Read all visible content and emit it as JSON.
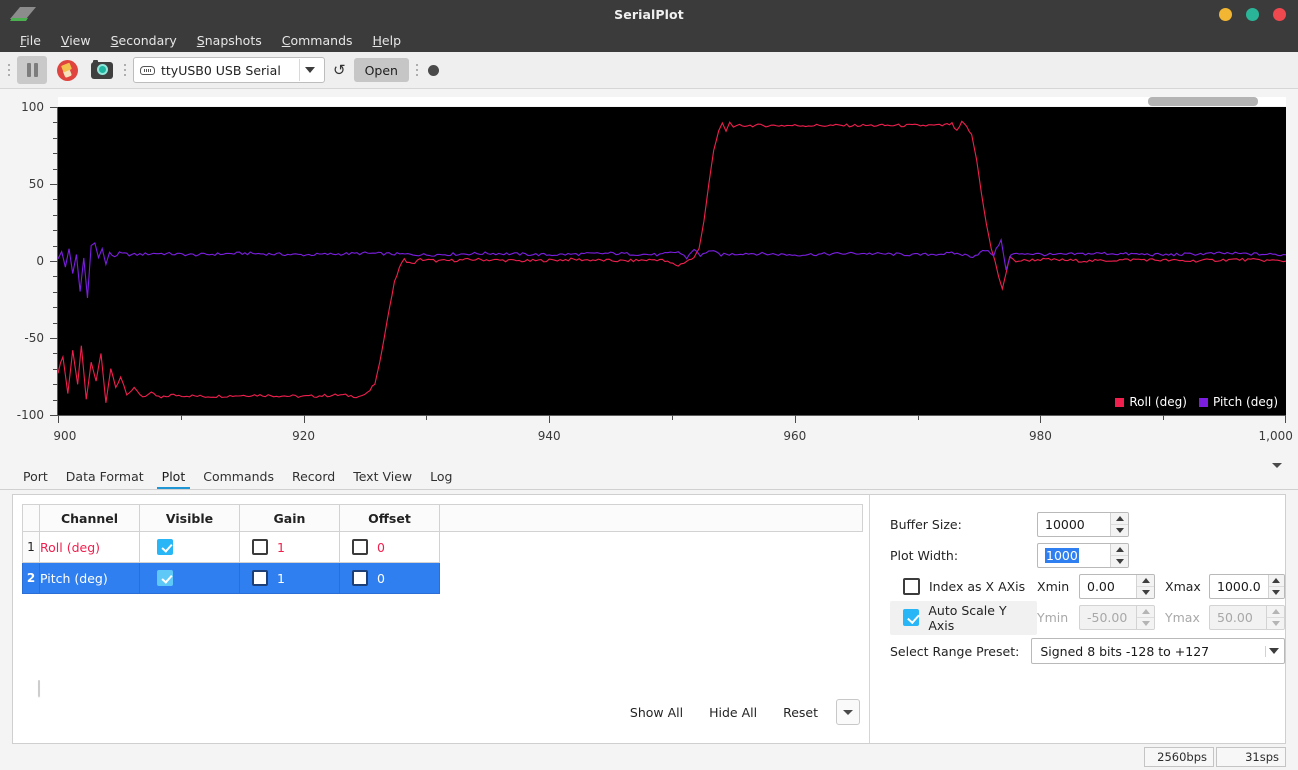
{
  "window": {
    "title": "SerialPlot",
    "logo_icon": "serialplot-logo-icon",
    "buttons": [
      {
        "name": "minimize",
        "color": "#f2b632"
      },
      {
        "name": "maximize",
        "color": "#2bb598"
      },
      {
        "name": "close",
        "color": "#f0484f"
      }
    ]
  },
  "menubar": {
    "items": [
      {
        "label": "File",
        "mnemonic": "F"
      },
      {
        "label": "View",
        "mnemonic": "V"
      },
      {
        "label": "Secondary",
        "mnemonic": "S"
      },
      {
        "label": "Snapshots",
        "mnemonic": "S"
      },
      {
        "label": "Commands",
        "mnemonic": "C"
      },
      {
        "label": "Help",
        "mnemonic": "H"
      }
    ]
  },
  "toolbar": {
    "pause_icon": "pause-icon",
    "clear_icon": "clear-plot-icon",
    "snapshot_icon": "camera-snapshot-icon",
    "port_icon": "serial-connector-icon",
    "port_value": "ttyUSB0 USB Serial",
    "refresh_icon": "refresh-ports-icon",
    "open_label": "Open",
    "record_indicator_icon": "record-indicator-icon"
  },
  "chart_data": {
    "type": "line",
    "title": "",
    "xlabel": "",
    "ylabel": "",
    "xlim": [
      900,
      1000
    ],
    "ylim": [
      -100,
      100
    ],
    "x_ticks": [
      "900",
      "920",
      "940",
      "960",
      "980",
      "1,000"
    ],
    "x_tick_values": [
      900,
      920,
      940,
      960,
      980,
      1000
    ],
    "x_minor_step": 10,
    "y_ticks": [
      "100",
      "50",
      "0",
      "-50",
      "-100"
    ],
    "y_tick_values": [
      100,
      50,
      0,
      -50,
      -100
    ],
    "y_minor_step": 10,
    "grid": false,
    "background": "#000000",
    "legend_position": "bottom-right",
    "series": [
      {
        "name": "Roll (deg)",
        "color": "#f01f4e",
        "description": "Starts near -80 with large noise spikes, settles to a -88 plateau, ramps up to 0 at x=926, flat near 0 until x=951, rises to +88 plateau from x=953 to x=974, then falls back to 0 with an overshoot spike at x=977",
        "points": [
          [
            900,
            -72
          ],
          [
            900.4,
            -62
          ],
          [
            900.8,
            -86
          ],
          [
            901.2,
            -58
          ],
          [
            901.6,
            -80
          ],
          [
            901.9,
            -55
          ],
          [
            902.3,
            -90
          ],
          [
            902.7,
            -66
          ],
          [
            903.1,
            -78
          ],
          [
            903.5,
            -60
          ],
          [
            903.9,
            -92
          ],
          [
            904.3,
            -70
          ],
          [
            904.7,
            -82
          ],
          [
            905.1,
            -75
          ],
          [
            905.6,
            -86
          ],
          [
            906.2,
            -83
          ],
          [
            906.9,
            -88
          ],
          [
            907.6,
            -86
          ],
          [
            908.4,
            -89
          ],
          [
            909.2,
            -87
          ],
          [
            912,
            -88
          ],
          [
            916,
            -87
          ],
          [
            920,
            -88
          ],
          [
            923,
            -87
          ],
          [
            924.5,
            -88
          ],
          [
            925.2,
            -86
          ],
          [
            925.8,
            -80
          ],
          [
            926.2,
            -66
          ],
          [
            926.6,
            -48
          ],
          [
            927,
            -30
          ],
          [
            927.4,
            -14
          ],
          [
            927.8,
            -4
          ],
          [
            928.2,
            1
          ],
          [
            928.8,
            -2
          ],
          [
            929.5,
            1
          ],
          [
            931,
            0
          ],
          [
            934,
            1
          ],
          [
            938,
            0
          ],
          [
            942,
            1
          ],
          [
            946,
            0
          ],
          [
            949,
            1
          ],
          [
            950.5,
            -3
          ],
          [
            951.2,
            0
          ],
          [
            951.8,
            2
          ],
          [
            952.2,
            8
          ],
          [
            952.6,
            26
          ],
          [
            953,
            50
          ],
          [
            953.4,
            72
          ],
          [
            953.8,
            84
          ],
          [
            954.1,
            90
          ],
          [
            954.4,
            84
          ],
          [
            954.7,
            91
          ],
          [
            955,
            86
          ],
          [
            955.5,
            88
          ],
          [
            957,
            88
          ],
          [
            960,
            88
          ],
          [
            964,
            88
          ],
          [
            968,
            88
          ],
          [
            970,
            88
          ],
          [
            972,
            88
          ],
          [
            972.8,
            89
          ],
          [
            973.2,
            84
          ],
          [
            973.6,
            90
          ],
          [
            974,
            87
          ],
          [
            974.4,
            82
          ],
          [
            974.8,
            66
          ],
          [
            975.2,
            44
          ],
          [
            975.6,
            24
          ],
          [
            976,
            8
          ],
          [
            976.3,
            0
          ],
          [
            976.6,
            -10
          ],
          [
            976.9,
            -18
          ],
          [
            977.2,
            -8
          ],
          [
            977.5,
            2
          ],
          [
            978,
            0
          ],
          [
            980,
            1
          ],
          [
            984,
            0
          ],
          [
            988,
            1
          ],
          [
            992,
            0
          ],
          [
            996,
            1
          ],
          [
            1000,
            0
          ]
        ]
      },
      {
        "name": "Pitch (deg)",
        "color": "#7b1ee0",
        "description": "Noisy burst near x=900 spanning roughly -24 to +12, then a steady near-zero trace with small ripple and a brief disturbance around x=951 and x=977",
        "points": [
          [
            900,
            2
          ],
          [
            900.3,
            6
          ],
          [
            900.6,
            -4
          ],
          [
            900.9,
            8
          ],
          [
            901.2,
            -8
          ],
          [
            901.5,
            4
          ],
          [
            901.8,
            -20
          ],
          [
            902.1,
            2
          ],
          [
            902.4,
            -24
          ],
          [
            902.7,
            10
          ],
          [
            903,
            12
          ],
          [
            903.3,
            2
          ],
          [
            903.6,
            8
          ],
          [
            903.9,
            -2
          ],
          [
            904.2,
            5
          ],
          [
            904.6,
            3
          ],
          [
            905,
            5
          ],
          [
            906,
            4
          ],
          [
            908,
            5
          ],
          [
            911,
            4
          ],
          [
            915,
            5
          ],
          [
            920,
            4
          ],
          [
            925,
            5
          ],
          [
            930,
            4
          ],
          [
            935,
            5
          ],
          [
            940,
            4
          ],
          [
            945,
            5
          ],
          [
            949,
            4
          ],
          [
            950.5,
            6
          ],
          [
            951.2,
            2
          ],
          [
            951.8,
            8
          ],
          [
            952.3,
            3
          ],
          [
            953,
            7
          ],
          [
            954,
            4
          ],
          [
            956,
            5
          ],
          [
            960,
            4
          ],
          [
            965,
            5
          ],
          [
            970,
            4
          ],
          [
            973,
            5
          ],
          [
            974.5,
            3
          ],
          [
            975.5,
            7
          ],
          [
            976.2,
            4
          ],
          [
            976.8,
            14
          ],
          [
            977.2,
            -6
          ],
          [
            977.6,
            4
          ],
          [
            978.5,
            5
          ],
          [
            981,
            4
          ],
          [
            985,
            5
          ],
          [
            990,
            4
          ],
          [
            995,
            5
          ],
          [
            1000,
            4
          ]
        ]
      }
    ]
  },
  "tabs": {
    "items": [
      "Port",
      "Data Format",
      "Plot",
      "Commands",
      "Record",
      "Text View",
      "Log"
    ],
    "active": "Plot",
    "more_icon": "tabs-overflow-icon"
  },
  "channel_table": {
    "columns": [
      "",
      "Channel",
      "Visible",
      "Gain",
      "Offset"
    ],
    "rows": [
      {
        "index": "1",
        "channel": "Roll (deg)",
        "channel_color": "#f01f4e",
        "visible": true,
        "gain_enabled": false,
        "gain": "1",
        "offset_enabled": false,
        "offset": "0",
        "selected": false
      },
      {
        "index": "2",
        "channel": "Pitch (deg)",
        "channel_color": "#7b1ee0",
        "visible": true,
        "gain_enabled": false,
        "gain": "1",
        "offset_enabled": false,
        "offset": "0",
        "selected": true
      }
    ],
    "buttons": {
      "show_all": "Show All",
      "hide_all": "Hide All",
      "reset": "Reset",
      "more_icon": "reset-options-icon"
    },
    "bottom_checkbox_checked": false
  },
  "settings": {
    "buffer_size_label": "Buffer Size:",
    "buffer_size_value": "10000",
    "plot_width_label": "Plot Width:",
    "plot_width_value": "1000",
    "plot_width_selected": true,
    "index_as_x_label": "Index as X AXis",
    "index_as_x_checked": false,
    "xmin_label": "Xmin",
    "xmin_value": "0.00",
    "xmax_label": "Xmax",
    "xmax_value": "1000.0",
    "autoscale_label": "Auto Scale Y Axis",
    "autoscale_checked": true,
    "ymin_label": "Ymin",
    "ymin_value": "-50.00",
    "ymax_label": "Ymax",
    "ymax_value": "50.00",
    "range_preset_label": "Select Range Preset:",
    "range_preset_value": "Signed 8 bits -128 to +127"
  },
  "statusbar": {
    "bitrate": "2560bps",
    "sample_rate": "31sps"
  }
}
